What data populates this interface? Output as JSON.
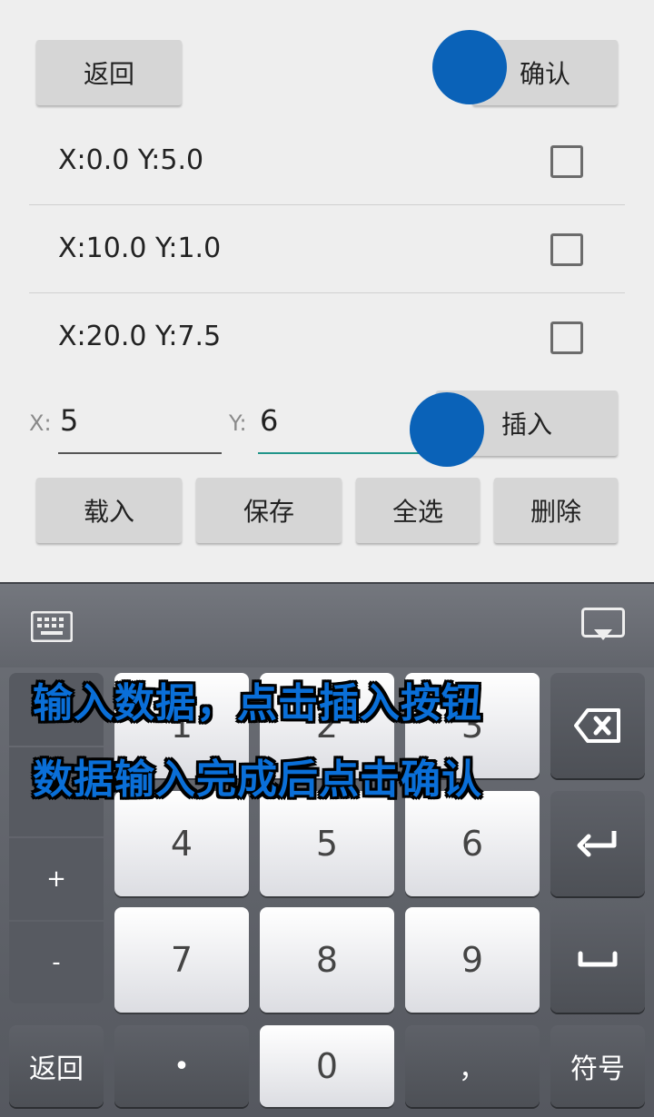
{
  "toolbar": {
    "back_label": "返回",
    "confirm_label": "确认"
  },
  "points": [
    {
      "label": "X:0.0 Y:5.0",
      "checked": false
    },
    {
      "label": "X:10.0 Y:1.0",
      "checked": false
    },
    {
      "label": "X:20.0 Y:7.5",
      "checked": false
    }
  ],
  "inputs": {
    "x_label": "X:",
    "x_value": "5",
    "y_label": "Y:",
    "y_value": "6",
    "insert_label": "插入"
  },
  "actions": {
    "load": "载入",
    "save": "保存",
    "select_all": "全选",
    "delete": "删除"
  },
  "keyboard": {
    "side_keys": [
      "#",
      "+",
      "-"
    ],
    "digits": [
      "1",
      "2",
      "3",
      "4",
      "5",
      "6",
      "7",
      "8",
      "9"
    ],
    "bottom": {
      "back": "返回",
      "dot": "•",
      "zero": "0",
      "comma": "，",
      "symbols": "符号"
    }
  },
  "overlay": {
    "line1": "输入数据，点击插入按钮",
    "line2": "数据输入完成后点击确认"
  },
  "colors": {
    "touch": "#0a62b8",
    "accent_line": "#21958a",
    "overlay_text": "#0a6fd8"
  }
}
